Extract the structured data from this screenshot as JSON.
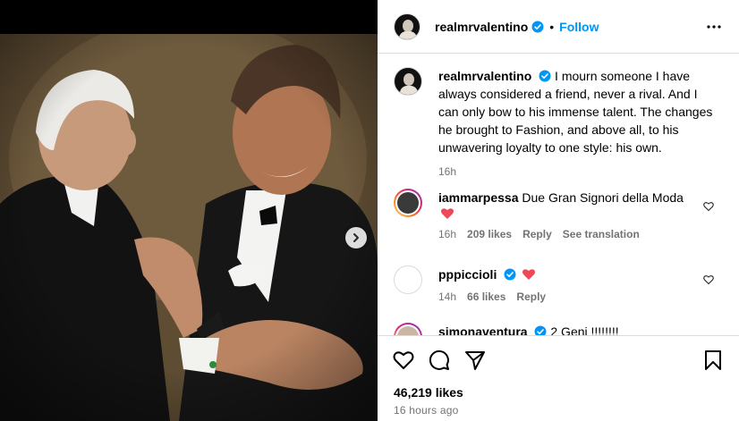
{
  "post": {
    "username": "realmrvalentino",
    "follow_label": "Follow",
    "separator": "•",
    "caption": {
      "username": "realmrvalentino",
      "text": "I mourn someone I have always considered a friend, never a rival. And I can only bow to his immense talent. The changes he brought to Fashion, and above all, to his unwavering loyalty to one style: his own.",
      "time": "16h"
    },
    "comments": [
      {
        "username": "iammarpessa",
        "text": "Due Gran Signori della Moda",
        "time": "16h",
        "likes": "209 likes",
        "reply": "Reply",
        "translate": "See translation"
      },
      {
        "username": "pppiccioli",
        "text": "",
        "time": "14h",
        "likes": "66 likes",
        "reply": "Reply"
      },
      {
        "username": "simonaventura",
        "text": "2 Geni !!!!!!!!"
      }
    ],
    "likes": "46,219 likes",
    "posted_ago": "16 hours ago"
  },
  "colors": {
    "accent": "#0095f6",
    "verified": "#0095f6",
    "heart": "#ed4956",
    "muted": "#737373",
    "divider": "#dbdbdb"
  },
  "icons": {
    "verified": "verified-badge-icon",
    "more": "more-options-icon",
    "next": "chevron-right-icon",
    "like": "heart-outline-icon",
    "comment": "comment-bubble-icon",
    "share": "paper-plane-icon",
    "save": "bookmark-icon"
  }
}
